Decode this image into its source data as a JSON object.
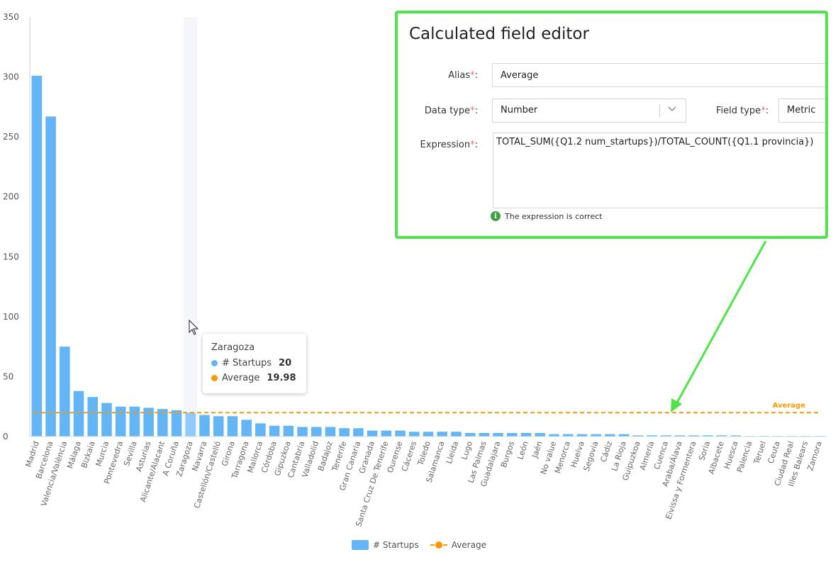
{
  "chart_data": {
    "type": "bar",
    "categories": [
      "Madrid",
      "Barcelona",
      "Valencia/València",
      "Málaga",
      "Bizkaia",
      "Murcia",
      "Pontevedra",
      "Sevilla",
      "Asturias",
      "Alicante/Alacant",
      "A Coruña",
      "Zaragoza",
      "Navarra",
      "Castellón/Castelló",
      "Girona",
      "Tarragona",
      "Mallorca",
      "Córdoba",
      "Gipuzkoa",
      "Cantabria",
      "Valladolid",
      "Badajoz",
      "Tenerife",
      "Gran Canaria",
      "Granada",
      "Santa Cruz De Tenerife",
      "Ourense",
      "Cáceres",
      "Toledo",
      "Salamanca",
      "Lleida",
      "Lugo",
      "Las Palmas",
      "Guadalajara",
      "Burgos",
      "León",
      "Jaén",
      "No value",
      "Menorca",
      "Huelva",
      "Segovia",
      "Cádiz",
      "La Rioja",
      "Guipuzkoa",
      "Almería",
      "Cuenca",
      "Araba/Álava",
      "Eivissa y Formentera",
      "Soria",
      "Albacete",
      "Huesca",
      "Palencia",
      "Teruel",
      "Ceuta",
      "Ciudad Real",
      "Illes Balears",
      "Zamora"
    ],
    "series": [
      {
        "name": "# Startups",
        "color": "#64b5f6",
        "values": [
          301,
          267,
          75,
          38,
          33,
          28,
          25,
          25,
          24,
          23,
          22,
          20,
          18,
          17,
          17,
          14,
          11,
          9,
          9,
          8,
          8,
          8,
          7,
          7,
          5,
          5,
          5,
          4,
          4,
          4,
          4,
          3,
          3,
          3,
          3,
          3,
          3,
          2,
          2,
          2,
          2,
          2,
          2,
          1,
          1,
          1,
          1,
          1,
          1,
          1,
          1,
          0.5,
          0.5,
          0.5,
          0.5,
          0.5,
          0.5
        ]
      },
      {
        "name": "Average",
        "type": "line",
        "style": "dashed",
        "color": "#ff9800",
        "value": 19.98
      }
    ],
    "average_label": "Average",
    "yticks": [
      0,
      50,
      100,
      150,
      200,
      250,
      300,
      350
    ],
    "ylim": [
      0,
      350
    ],
    "highlighted_category": "Zaragoza",
    "grid": false,
    "legend_position": "bottom-center"
  },
  "tooltip": {
    "title": "Zaragoza",
    "rows": [
      {
        "label": "# Startups",
        "value": "20",
        "color": "#64b5f6"
      },
      {
        "label": "Average",
        "value": "19.98",
        "color": "#ff9800"
      }
    ]
  },
  "legend": {
    "bars": "# Startups",
    "line": "Average"
  },
  "editor": {
    "title": "Calculated field editor",
    "alias_label": "Alias",
    "alias_value": "Average",
    "datatype_label": "Data type",
    "datatype_value": "Number",
    "fieldtype_label": "Field type",
    "fieldtype_value": "Metric",
    "expression_label": "Expression",
    "expression_value": "TOTAL_SUM({Q1.2 num_startups})/TOTAL_COUNT({Q1.1 provincia})",
    "required_mark": "*",
    "colon": ":",
    "status_text": "The expression is correct",
    "status_icon": "i",
    "highlight_color": "#4ee44a"
  }
}
